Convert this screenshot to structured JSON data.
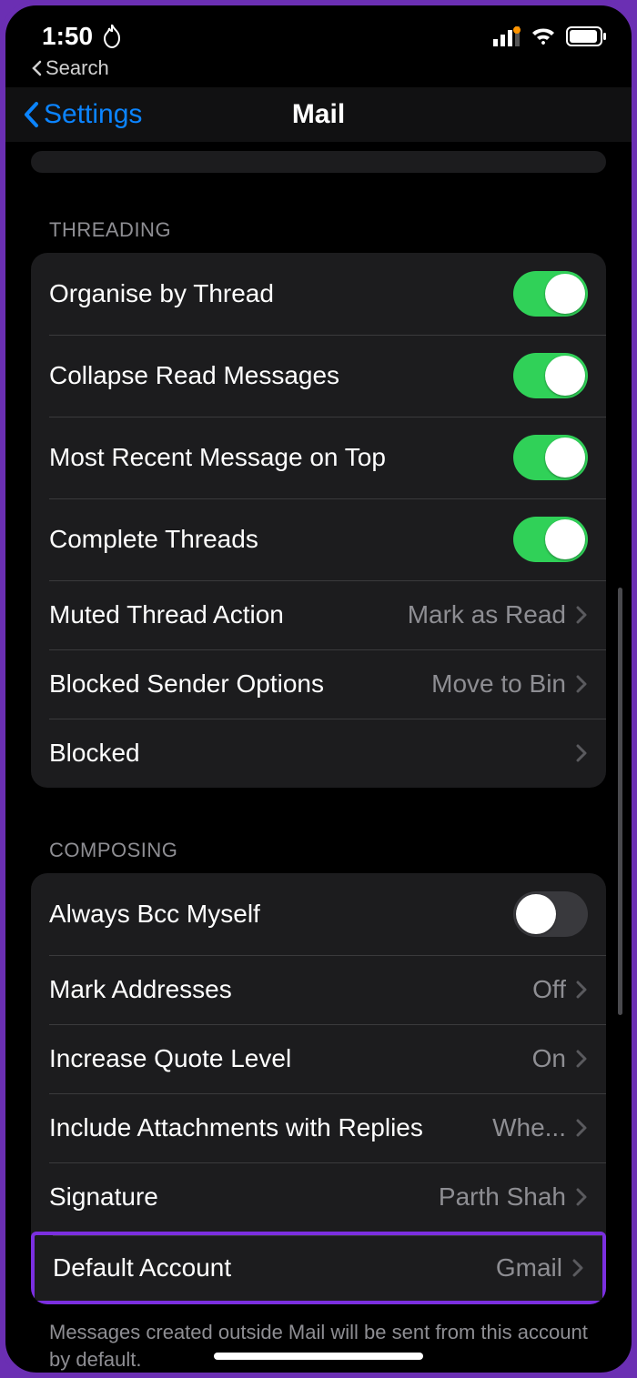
{
  "status": {
    "time": "1:50"
  },
  "breadcrumb": {
    "label": "Search"
  },
  "nav": {
    "back": "Settings",
    "title": "Mail"
  },
  "threading": {
    "header": "THREADING",
    "organise": "Organise by Thread",
    "collapse": "Collapse Read Messages",
    "recentTop": "Most Recent Message on Top",
    "complete": "Complete Threads",
    "muted": {
      "label": "Muted Thread Action",
      "value": "Mark as Read"
    },
    "blockedSender": {
      "label": "Blocked Sender Options",
      "value": "Move to Bin"
    },
    "blocked": "Blocked"
  },
  "composing": {
    "header": "COMPOSING",
    "bcc": "Always Bcc Myself",
    "mark": {
      "label": "Mark Addresses",
      "value": "Off"
    },
    "quote": {
      "label": "Increase Quote Level",
      "value": "On"
    },
    "attach": {
      "label": "Include Attachments with Replies",
      "value": "Whe..."
    },
    "signature": {
      "label": "Signature",
      "value": "Parth Shah"
    },
    "default": {
      "label": "Default Account",
      "value": "Gmail"
    },
    "footer": "Messages created outside Mail will be sent from this account by default."
  }
}
